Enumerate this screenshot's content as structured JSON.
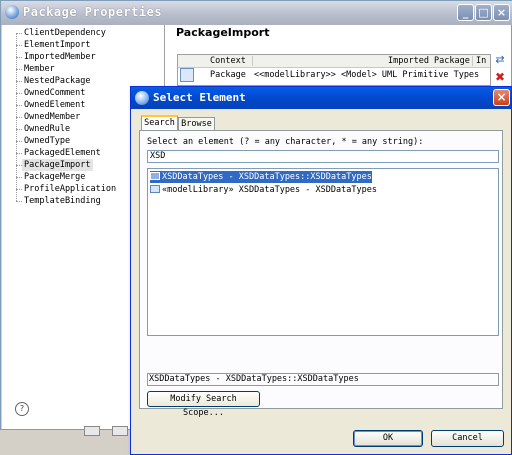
{
  "package_properties": {
    "title": "Package Properties",
    "buttons": {
      "minimize": "_",
      "maximize": "□",
      "close": "×"
    },
    "tree": [
      "ClientDependency",
      "ElementImport",
      "ImportedMember",
      "Member",
      "NestedPackage",
      "OwnedComment",
      "OwnedElement",
      "OwnedMember",
      "OwnedRule",
      "OwnedType",
      "PackagedElement",
      "PackageImport",
      "PackageMerge",
      "ProfileApplication",
      "TemplateBinding"
    ],
    "selected_tree_item": "PackageImport",
    "help_icon": "?",
    "section_title": "PackageImport",
    "table": {
      "headers": [
        "Context",
        "Imported Package",
        "In"
      ],
      "row": {
        "context": "Package",
        "imported_package": "<<modelLibrary>> <Model> UML Primitive Types"
      }
    },
    "add_icon": "⇄",
    "delete_icon": "✖"
  },
  "dialog": {
    "title": "Select Element",
    "close": "×",
    "tabs": [
      "Search",
      "Browse"
    ],
    "active_tab": "Search",
    "prompt": "Select an element (? = any character, * = any string):",
    "search_value": "XSD",
    "results": [
      {
        "label": "XSDDataTypes - XSDDataTypes::XSDDataTypes",
        "selected": true
      },
      {
        "label": "«modelLibrary» XSDDataTypes - XSDDataTypes",
        "selected": false
      }
    ],
    "detail": "XSDDataTypes - XSDDataTypes::XSDDataTypes",
    "scope_button": "Modify Search Scope...",
    "ok_button": "OK",
    "cancel_button": "Cancel"
  },
  "colors": {
    "dialog_title": "#0454e0",
    "selection": "#316ac5",
    "tab_highlight": "#ffc83c"
  }
}
